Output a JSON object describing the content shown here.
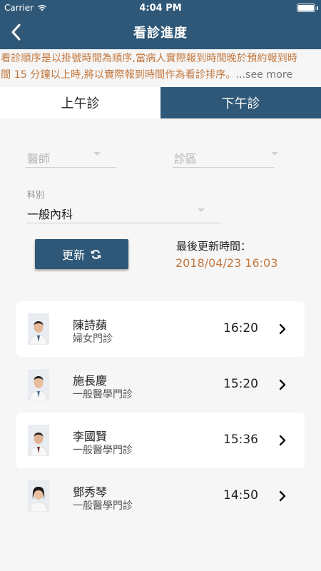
{
  "status_bar": {
    "carrier": "Carrier",
    "time": "4:04 PM"
  },
  "nav": {
    "title": "看診進度",
    "back_icon": "chevron-left-icon"
  },
  "notice": {
    "line1": "看診順序是以掛號時間為順序,當病人實際報到時間晚於預約報到時",
    "line2": "間 15 分鐘以上時,將以實際報到時間作為看診排序。",
    "see_more": "...see more"
  },
  "tabs": [
    {
      "label": "上午診",
      "active": false
    },
    {
      "label": "下午診",
      "active": true
    }
  ],
  "filters": {
    "doctor_placeholder": "醫師",
    "area_placeholder": "診區",
    "dept_label": "科別",
    "dept_value": "一般內科"
  },
  "refresh": {
    "label": "更新",
    "icon": "refresh-icon"
  },
  "last_update": {
    "label": "最後更新時間：",
    "value": "2018/04/23 16:03"
  },
  "doctors": [
    {
      "name": "陳詩蘋",
      "dept": "婦女門診",
      "time": "16:20"
    },
    {
      "name": "施長慶",
      "dept": "一般醫學門診",
      "time": "15:20"
    },
    {
      "name": "李國賢",
      "dept": "一般醫學門診",
      "time": "15:36"
    },
    {
      "name": "鄧秀琴",
      "dept": "一般醫學門診",
      "time": "14:50"
    }
  ],
  "colors": {
    "primary": "#2f5878",
    "accent": "#c3783f",
    "background": "#f6f6f6"
  }
}
